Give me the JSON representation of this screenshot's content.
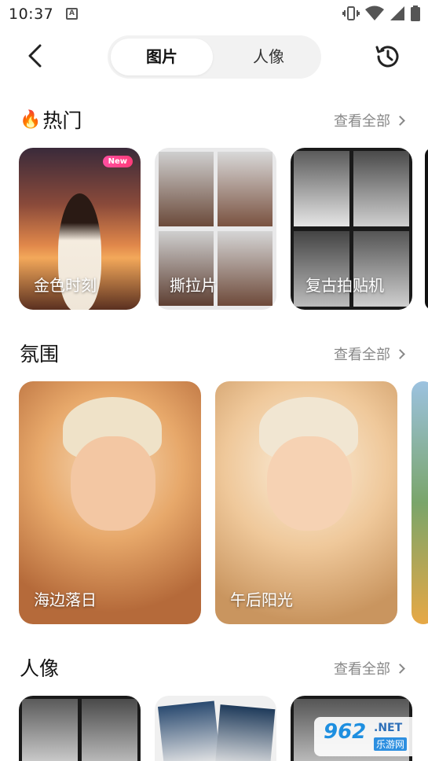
{
  "status_bar": {
    "time": "10:37",
    "a_icon": "A",
    "icons": [
      "vibrate-icon",
      "wifi-icon",
      "signal-icon",
      "battery-icon"
    ]
  },
  "header": {
    "tabs": [
      {
        "label": "图片",
        "active": true
      },
      {
        "label": "人像",
        "active": false
      }
    ]
  },
  "sections": [
    {
      "title": "热门",
      "emoji": "🔥",
      "see_all": "查看全部",
      "cards": [
        {
          "label": "金色时刻",
          "badge": "New"
        },
        {
          "label": "撕拉片",
          "badge": ""
        },
        {
          "label": "复古拍贴机",
          "badge": ""
        }
      ]
    },
    {
      "title": "氛围",
      "see_all": "查看全部",
      "cards": [
        {
          "label": "海边落日"
        },
        {
          "label": "午后阳光"
        }
      ]
    },
    {
      "title": "人像",
      "see_all": "查看全部",
      "cards": []
    }
  ],
  "watermark": {
    "num": "962",
    "net": ".NET",
    "cn": "乐游网"
  },
  "colors": {
    "accent_new": "#ff3c7a",
    "muted": "#888888",
    "segment_bg": "#f2f2f2"
  }
}
